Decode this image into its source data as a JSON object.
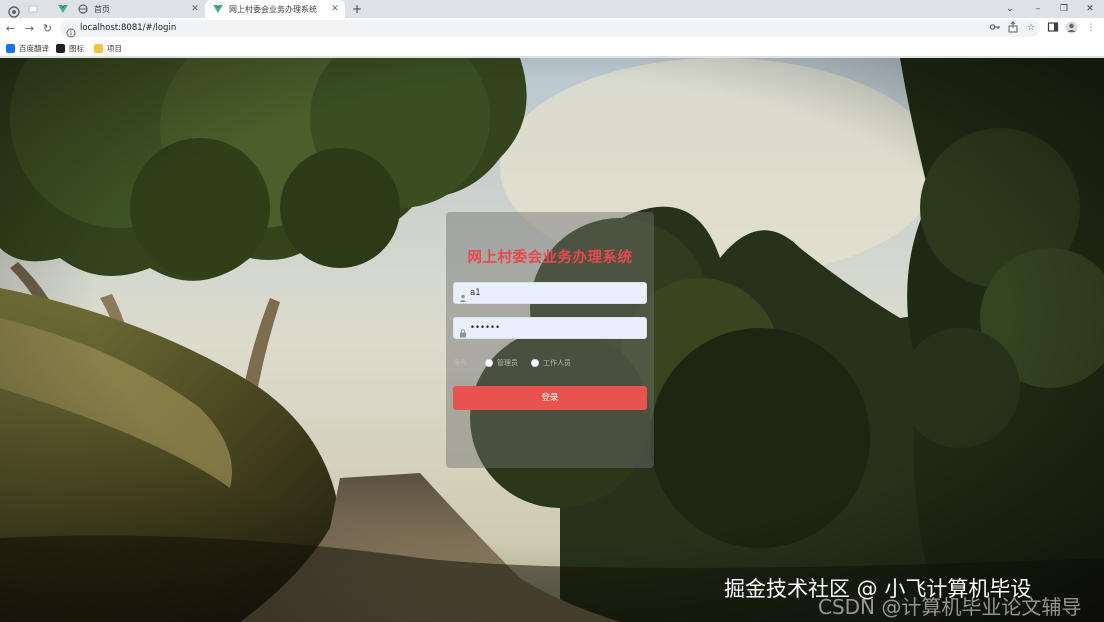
{
  "browser": {
    "tabs": [
      {
        "title": "",
        "active": false
      },
      {
        "title": "首页",
        "active": false
      },
      {
        "title": "网上村委会业务办理系统",
        "active": true
      }
    ],
    "new_tab_label": "+",
    "window_controls": [
      "⌄",
      "–",
      "❐",
      "✕"
    ],
    "url": "localhost:8081/#/login",
    "bookmarks": [
      {
        "label": "百度翻译",
        "color": "#1a73e8"
      },
      {
        "label": "图标",
        "color": "#202124"
      },
      {
        "label": "项目",
        "color": "#f4c542"
      }
    ]
  },
  "login": {
    "title": "网上村委会业务办理系统",
    "username_value": "a1",
    "password_value": "••••••",
    "role_label": "角色",
    "roles": [
      "管理员",
      "工作人员"
    ],
    "submit_label": "登录",
    "accent_color": "#e8534f"
  },
  "watermark": {
    "main": "掘金技术社区 @ 小飞计算机毕设",
    "sub": "CSDN @计算机毕业论文辅导"
  }
}
